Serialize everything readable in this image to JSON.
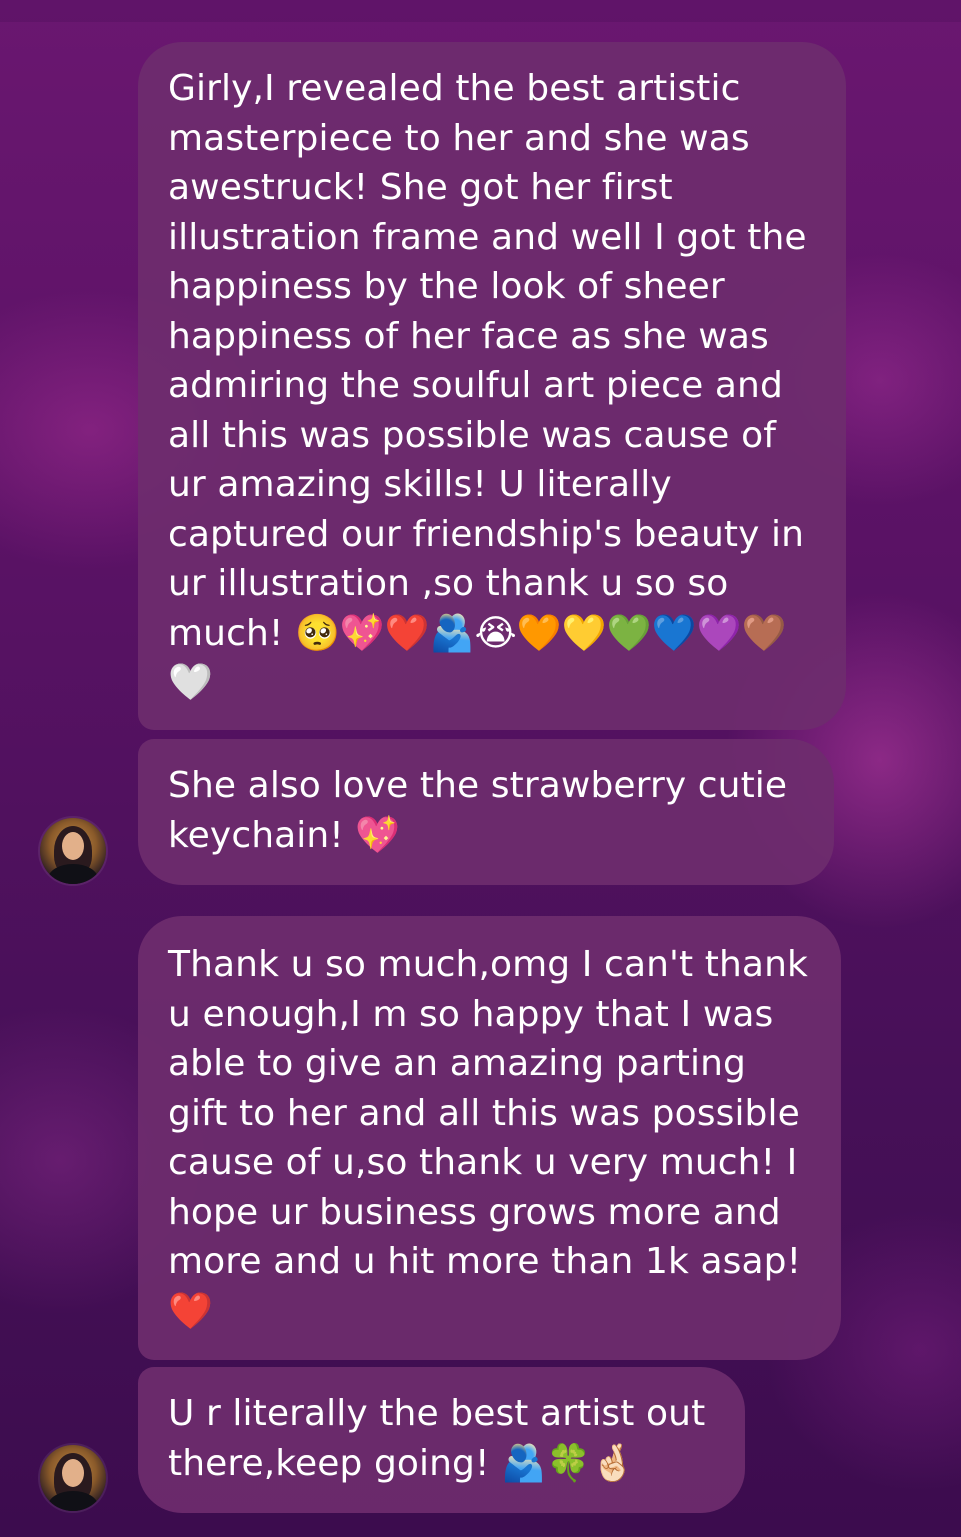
{
  "messages": [
    {
      "text": "Girly,I revealed the best artistic masterpiece to her and she was awestruck! She got her first illustration frame and well I got the happiness by the look of sheer happiness of her face as she was admiring the soulful art piece and all this was possible was cause of ur amazing skills! U literally captured our friendship's beauty in ur illustration ,so thank u so so much! 🥺💖❤️🫂😭🧡💛💚💙💜🤎🤍"
    },
    {
      "text": "She also love the strawberry cutie keychain! 💖"
    },
    {
      "text": "Thank u so much,omg I can't thank u enough,I m so happy that I was able to give an amazing parting gift to her and all this was possible cause of u,so thank u very much! I hope ur business grows more and more and u hit more than 1k asap! ❤️"
    },
    {
      "text": "U r literally the best artist out there,keep going! 🫂🍀🤞🏻"
    }
  ],
  "colors": {
    "bubble": "#6e2d6e",
    "background_top": "#6a1770",
    "background_bottom": "#3c0c4e",
    "text": "#ffffff"
  }
}
